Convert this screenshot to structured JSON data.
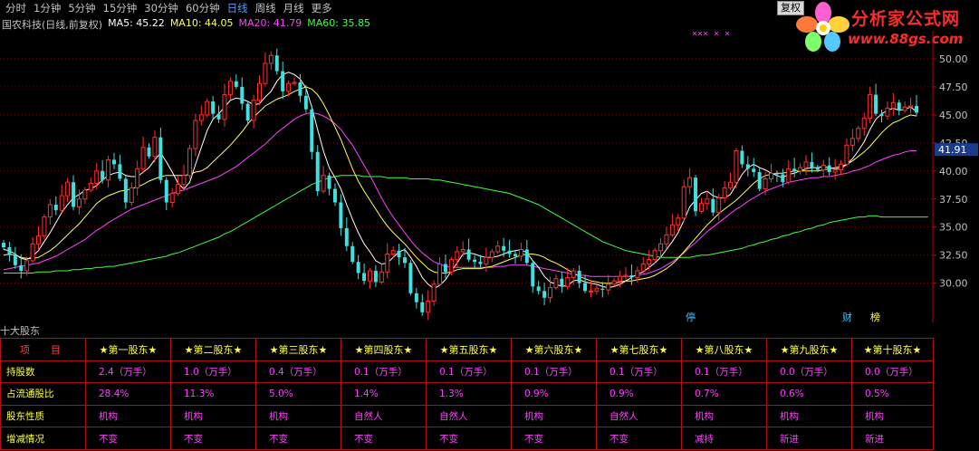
{
  "toolbar": {
    "periods": [
      "分时",
      "1分钟",
      "5分钟",
      "15分钟",
      "30分钟",
      "60分钟",
      "日线",
      "周线",
      "月线",
      "更多"
    ],
    "active_period": "日线",
    "restore_label": "复权"
  },
  "logo": {
    "title": "分析家公式网",
    "url": "www.88gs.com"
  },
  "legend": {
    "stock_title": "国农科技(日线,前复权)",
    "ma5": "MA5: 45.22",
    "ma10": "MA10: 44.05",
    "ma20": "MA20: 41.79",
    "ma60": "MA60: 35.85"
  },
  "chart_data": {
    "type": "candlestick",
    "y_ticks": [
      "50.00",
      "47.50",
      "45.00",
      "42.50",
      "40.00",
      "37.50",
      "35.00",
      "32.50",
      "30.00"
    ],
    "ylim": [
      26.5,
      52.5
    ],
    "current_price": "41.91",
    "high_label": "52.83",
    "low_label": "25.80",
    "markers_top": "×××    ×    ×",
    "markers_bottom": [
      "停",
      "财",
      "榜"
    ],
    "colors": {
      "up": "#ff3030",
      "down": "#40e0e0",
      "ma5": "#ffffff",
      "ma10": "#ffff55",
      "ma20": "#ff40ff",
      "ma60": "#40ff40",
      "grid": "#7a0000",
      "axis": "#c00000",
      "tick": "#c0c0c0"
    },
    "closes": [
      33.2,
      32.5,
      31.6,
      31.1,
      32.0,
      33.5,
      34.2,
      35.9,
      37.0,
      36.5,
      37.8,
      39.0,
      36.8,
      37.5,
      38.3,
      38.9,
      40.0,
      39.2,
      41.0,
      40.6,
      39.3,
      37.2,
      38.5,
      40.2,
      42.1,
      41.3,
      43.0,
      39.2,
      37.2,
      38.0,
      38.8,
      39.6,
      42.0,
      44.5,
      45.0,
      46.2,
      45.1,
      44.6,
      46.8,
      48.0,
      47.5,
      46.0,
      44.5,
      46.3,
      47.8,
      49.6,
      50.3,
      48.9,
      47.1,
      47.8,
      47.9,
      46.7,
      45.5,
      41.7,
      38.2,
      39.6,
      38.4,
      37.2,
      34.9,
      33.3,
      31.9,
      30.9,
      30.2,
      31.1,
      30.1,
      31.0,
      32.6,
      32.9,
      32.3,
      31.8,
      29.1,
      28.3,
      27.4,
      28.4,
      29.9,
      31.7,
      31.0,
      32.1,
      32.8,
      33.0,
      32.1,
      31.9,
      31.7,
      32.3,
      32.8,
      33.3,
      32.9,
      32.6,
      32.4,
      33.0,
      31.8,
      29.7,
      29.3,
      28.7,
      29.6,
      30.4,
      29.7,
      30.5,
      31.1,
      30.0,
      29.3,
      29.3,
      29.5,
      29.4,
      29.9,
      30.2,
      30.6,
      30.7,
      30.5,
      31.1,
      31.7,
      32.1,
      32.9,
      33.5,
      34.3,
      35.2,
      35.8,
      38.6,
      39.4,
      36.4,
      37.1,
      37.5,
      36.3,
      37.6,
      38.5,
      39.0,
      41.8,
      40.6,
      40.2,
      39.9,
      38.4,
      39.3,
      39.8,
      39.7,
      39.0,
      40.2,
      40.0,
      40.3,
      40.8,
      40.3,
      40.1,
      40.5,
      39.9,
      40.1,
      40.6,
      42.3,
      42.9,
      43.8,
      44.7,
      46.8,
      45.1,
      44.9,
      45.6,
      46.1,
      45.4,
      45.7,
      45.8,
      45.2
    ],
    "ma5": [
      33.0,
      32.9,
      32.6,
      32.2,
      32.1,
      32.4,
      32.9,
      33.7,
      34.5,
      35.4,
      36.3,
      37.0,
      37.6,
      37.9,
      38.3,
      38.4,
      38.7,
      39.2,
      39.6,
      39.8,
      39.9,
      39.6,
      39.5,
      39.5,
      39.9,
      40.3,
      41.0,
      41.6,
      40.8,
      39.9,
      38.9,
      38.4,
      39.0,
      40.6,
      42.1,
      43.6,
      44.6,
      45.1,
      45.7,
      46.3,
      46.5,
      46.4,
      46.2,
      45.9,
      46.0,
      46.6,
      47.1,
      48.0,
      48.6,
      48.8,
      48.6,
      48.2,
      47.4,
      45.7,
      43.7,
      41.8,
      40.3,
      39.4,
      38.4,
      37.0,
      35.7,
      34.5,
      33.5,
      32.8,
      32.0,
      31.7,
      31.8,
      32.3,
      32.8,
      33.0,
      32.3,
      31.5,
      30.5,
      29.9,
      29.5,
      29.8,
      30.3,
      31.1,
      31.8,
      32.6,
      32.7,
      32.6,
      32.4,
      32.3,
      32.3,
      32.4,
      32.6,
      32.8,
      32.9,
      33.0,
      32.7,
      32.0,
      31.4,
      30.6,
      30.1,
      29.9,
      29.7,
      29.8,
      30.2,
      30.3,
      30.1,
      30.0,
      29.9,
      29.7,
      29.6,
      29.7,
      29.9,
      30.2,
      30.5,
      30.8,
      31.0,
      31.4,
      31.8,
      32.3,
      33.0,
      33.7,
      34.5,
      35.6,
      36.8,
      37.4,
      38.0,
      38.2,
      37.8,
      37.6,
      37.6,
      37.9,
      38.8,
      39.7,
      40.3,
      40.6,
      40.3,
      40.1,
      39.8,
      39.6,
      39.4,
      39.7,
      39.8,
      40.0,
      40.2,
      40.3,
      40.3,
      40.4,
      40.3,
      40.2,
      40.2,
      40.6,
      41.1,
      41.8,
      42.6,
      43.7,
      44.6,
      45.1,
      45.4,
      45.6,
      45.4,
      45.5,
      45.7,
      45.3
    ],
    "ma10": [
      32.5,
      32.6,
      32.5,
      32.3,
      32.2,
      32.2,
      32.3,
      32.6,
      32.9,
      33.3,
      33.8,
      34.3,
      34.8,
      35.3,
      35.9,
      36.5,
      37.1,
      37.5,
      37.8,
      38.0,
      38.2,
      38.3,
      38.4,
      38.6,
      38.8,
      39.1,
      39.3,
      39.5,
      39.6,
      39.6,
      39.6,
      39.6,
      39.7,
      39.9,
      40.0,
      40.3,
      40.8,
      41.3,
      41.8,
      42.3,
      42.9,
      43.5,
      44.2,
      44.8,
      45.3,
      45.8,
      46.1,
      46.4,
      46.6,
      46.8,
      47.1,
      47.3,
      47.5,
      47.3,
      46.8,
      46.0,
      45.0,
      43.9,
      42.8,
      41.5,
      40.2,
      39.1,
      38.2,
      37.4,
      36.6,
      35.8,
      35.1,
      34.5,
      34.0,
      33.5,
      32.9,
      32.3,
      31.8,
      31.3,
      31.0,
      30.9,
      30.9,
      31.0,
      31.2,
      31.3,
      31.3,
      31.3,
      31.3,
      31.4,
      31.5,
      31.7,
      31.9,
      32.1,
      32.3,
      32.5,
      32.6,
      32.6,
      32.5,
      32.3,
      32.0,
      31.8,
      31.5,
      31.2,
      30.9,
      30.6,
      30.4,
      30.2,
      30.1,
      30.0,
      30.0,
      30.0,
      30.1,
      30.2,
      30.2,
      30.3,
      30.4,
      30.5,
      30.7,
      31.0,
      31.3,
      31.7,
      32.2,
      32.8,
      33.4,
      34.0,
      34.6,
      35.2,
      35.7,
      36.2,
      36.6,
      37.0,
      37.4,
      37.9,
      38.4,
      38.9,
      39.3,
      39.6,
      39.7,
      39.8,
      39.8,
      39.9,
      40.0,
      40.0,
      40.0,
      40.0,
      40.0,
      40.1,
      40.2,
      40.3,
      40.4,
      40.6,
      40.9,
      41.3,
      41.7,
      42.2,
      42.8,
      43.4,
      43.9,
      44.3,
      44.5,
      44.8,
      45.0,
      44.9
    ],
    "ma20": [
      31.2,
      31.3,
      31.4,
      31.5,
      31.6,
      31.7,
      31.8,
      32.0,
      32.2,
      32.4,
      32.7,
      33.0,
      33.3,
      33.6,
      33.9,
      34.3,
      34.7,
      35.0,
      35.4,
      35.7,
      36.0,
      36.3,
      36.6,
      36.8,
      37.0,
      37.2,
      37.4,
      37.6,
      37.8,
      38.0,
      38.2,
      38.3,
      38.5,
      38.7,
      38.9,
      39.1,
      39.3,
      39.5,
      39.8,
      40.1,
      40.4,
      40.8,
      41.2,
      41.6,
      42.0,
      42.4,
      42.9,
      43.4,
      43.8,
      44.2,
      44.6,
      44.9,
      45.1,
      45.2,
      45.1,
      44.9,
      44.6,
      44.2,
      43.7,
      43.0,
      42.3,
      41.4,
      40.5,
      39.6,
      38.6,
      37.6,
      36.7,
      35.9,
      35.2,
      34.5,
      33.8,
      33.2,
      32.7,
      32.3,
      31.9,
      31.7,
      31.5,
      31.4,
      31.4,
      31.4,
      31.4,
      31.4,
      31.4,
      31.4,
      31.4,
      31.5,
      31.5,
      31.6,
      31.6,
      31.6,
      31.6,
      31.5,
      31.4,
      31.3,
      31.2,
      31.1,
      31.0,
      30.9,
      30.8,
      30.7,
      30.7,
      30.6,
      30.6,
      30.6,
      30.6,
      30.6,
      30.6,
      30.6,
      30.6,
      30.7,
      30.8,
      30.9,
      31.1,
      31.3,
      31.6,
      31.9,
      32.3,
      32.7,
      33.2,
      33.6,
      34.1,
      34.6,
      35.0,
      35.4,
      35.8,
      36.2,
      36.6,
      36.9,
      37.3,
      37.6,
      37.9,
      38.2,
      38.4,
      38.6,
      38.8,
      39.0,
      39.1,
      39.2,
      39.3,
      39.4,
      39.4,
      39.5,
      39.5,
      39.6,
      39.7,
      39.8,
      40.0,
      40.1,
      40.3,
      40.5,
      40.8,
      41.0,
      41.2,
      41.4,
      41.5,
      41.7,
      41.8,
      41.8
    ],
    "ma60": [
      30.9,
      30.9,
      30.9,
      30.9,
      30.9,
      30.9,
      31.0,
      31.0,
      31.0,
      31.1,
      31.1,
      31.1,
      31.2,
      31.2,
      31.3,
      31.3,
      31.4,
      31.4,
      31.5,
      31.5,
      31.6,
      31.7,
      31.8,
      31.9,
      32.0,
      32.1,
      32.2,
      32.3,
      32.4,
      32.6,
      32.7,
      32.9,
      33.1,
      33.3,
      33.5,
      33.7,
      33.9,
      34.1,
      34.4,
      34.6,
      34.9,
      35.2,
      35.5,
      35.8,
      36.1,
      36.4,
      36.7,
      37.0,
      37.3,
      37.6,
      37.9,
      38.2,
      38.5,
      38.8,
      39.0,
      39.2,
      39.4,
      39.5,
      39.6,
      39.6,
      39.6,
      39.6,
      39.5,
      39.5,
      39.5,
      39.5,
      39.4,
      39.4,
      39.4,
      39.4,
      39.3,
      39.3,
      39.3,
      39.3,
      39.2,
      39.2,
      39.1,
      39.0,
      38.9,
      38.8,
      38.7,
      38.6,
      38.5,
      38.4,
      38.3,
      38.2,
      38.1,
      38.0,
      37.8,
      37.6,
      37.4,
      37.2,
      37.0,
      36.7,
      36.4,
      36.1,
      35.8,
      35.5,
      35.2,
      34.9,
      34.6,
      34.3,
      34.0,
      33.7,
      33.5,
      33.3,
      33.1,
      32.9,
      32.8,
      32.7,
      32.6,
      32.5,
      32.4,
      32.3,
      32.3,
      32.3,
      32.3,
      32.3,
      32.3,
      32.4,
      32.5,
      32.5,
      32.6,
      32.7,
      32.8,
      32.9,
      33.0,
      33.1,
      33.3,
      33.4,
      33.6,
      33.7,
      33.9,
      34.0,
      34.2,
      34.3,
      34.5,
      34.6,
      34.8,
      34.9,
      35.1,
      35.2,
      35.4,
      35.5,
      35.6,
      35.7,
      35.8,
      35.9,
      35.9,
      36.0,
      36.0,
      35.9,
      35.9,
      35.9,
      35.9,
      35.9,
      35.9,
      35.9,
      35.9,
      35.9
    ]
  },
  "lower_panel": {
    "label": "十大股东",
    "header": [
      "项　目",
      "★第一股东★",
      "★第二股东★",
      "★第三股东★",
      "★第四股东★",
      "★第五股东★",
      "★第六股东★",
      "★第七股东★",
      "★第八股东★",
      "★第九股东★",
      "★第十股东★"
    ],
    "rows": [
      {
        "label": "持股数",
        "cells": [
          "2.4（万手）",
          "1.0（万手）",
          "0.4（万手）",
          "0.1（万手）",
          "0.1（万手）",
          "0.1（万手）",
          "0.1（万手）",
          "0.1（万手）",
          "0.0（万手）",
          "0.0（万手）"
        ]
      },
      {
        "label": "占流通股比",
        "cells": [
          "28.4%",
          "11.3%",
          "5.0%",
          "1.4%",
          "1.3%",
          "0.9%",
          "0.9%",
          "0.7%",
          "0.6%",
          "0.5%"
        ]
      },
      {
        "label": "股东性质",
        "cells": [
          "机构",
          "机构",
          "机构",
          "自然人",
          "自然人",
          "机构",
          "自然人",
          "机构",
          "机构",
          "机构"
        ]
      },
      {
        "label": "增减情况",
        "cells": [
          "不变",
          "不变",
          "不变",
          "不变",
          "不变",
          "不变",
          "不变",
          "减持",
          "新进",
          "新进"
        ]
      }
    ]
  }
}
